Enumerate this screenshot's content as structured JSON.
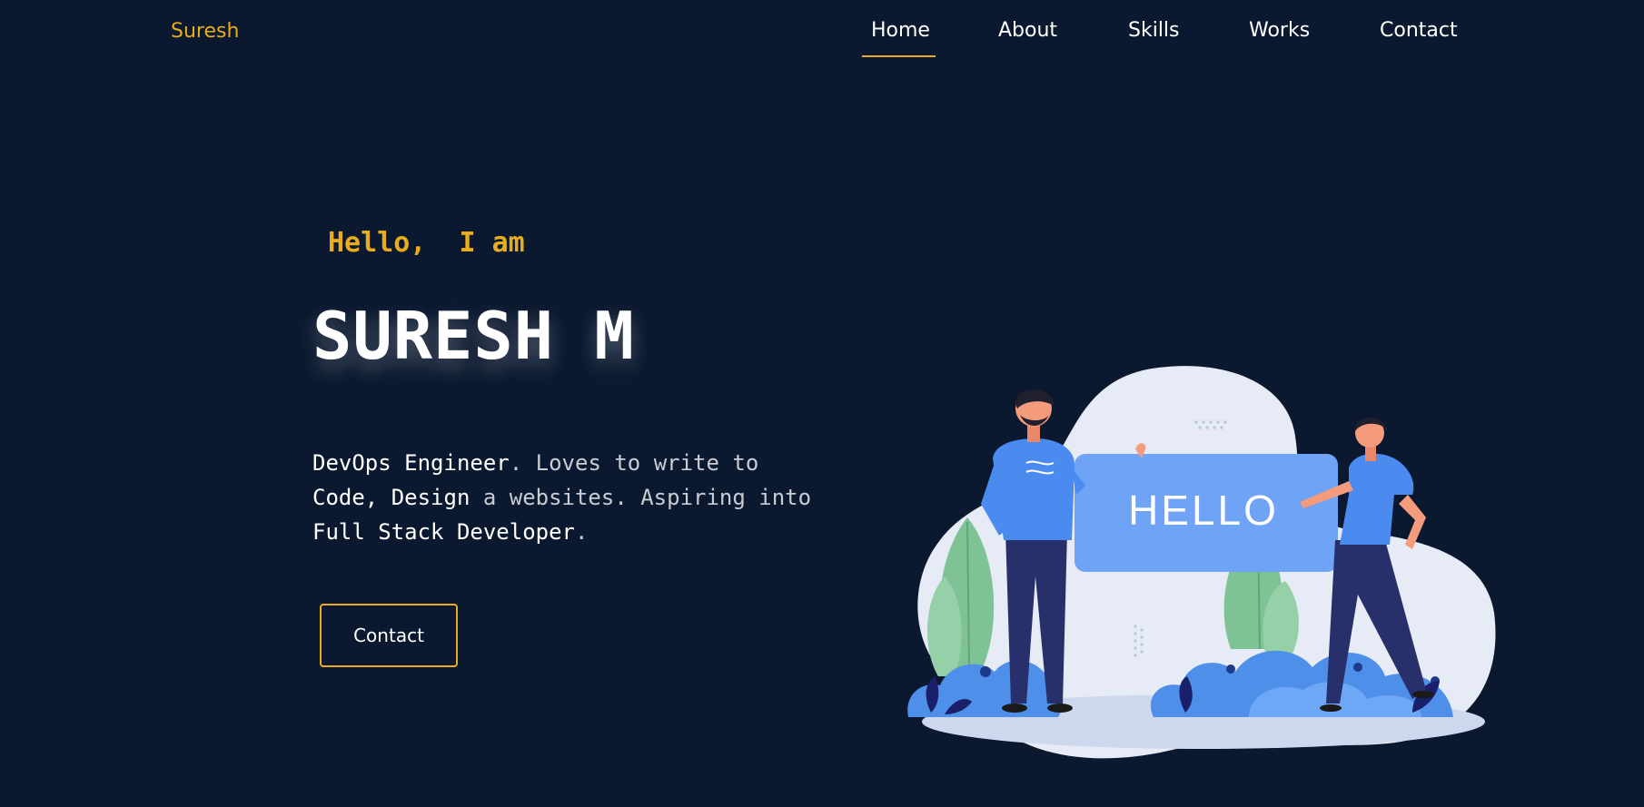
{
  "brand": {
    "name": "Suresh"
  },
  "nav": {
    "items": [
      {
        "label": "Home",
        "active": true
      },
      {
        "label": "About"
      },
      {
        "label": "Skills"
      },
      {
        "label": "Works"
      },
      {
        "label": "Contact"
      }
    ]
  },
  "hero": {
    "greeting": "Hello,  I am",
    "name": "SURESH M",
    "description": {
      "line1_a": "DevOps Engineer",
      "line1_b": ". Loves to write to",
      "line2_a": "Code, Design",
      "line2_b": " a websites. Aspiring into",
      "line3_a": "Full Stack Developer",
      "line3_b": "."
    },
    "contact_button": "Contact",
    "illustration_sign": "HELLO"
  },
  "colors": {
    "background": "#0b1930",
    "accent": "#e8ac1c",
    "text": "#ffffff",
    "muted_text": "#c9ccd3"
  }
}
